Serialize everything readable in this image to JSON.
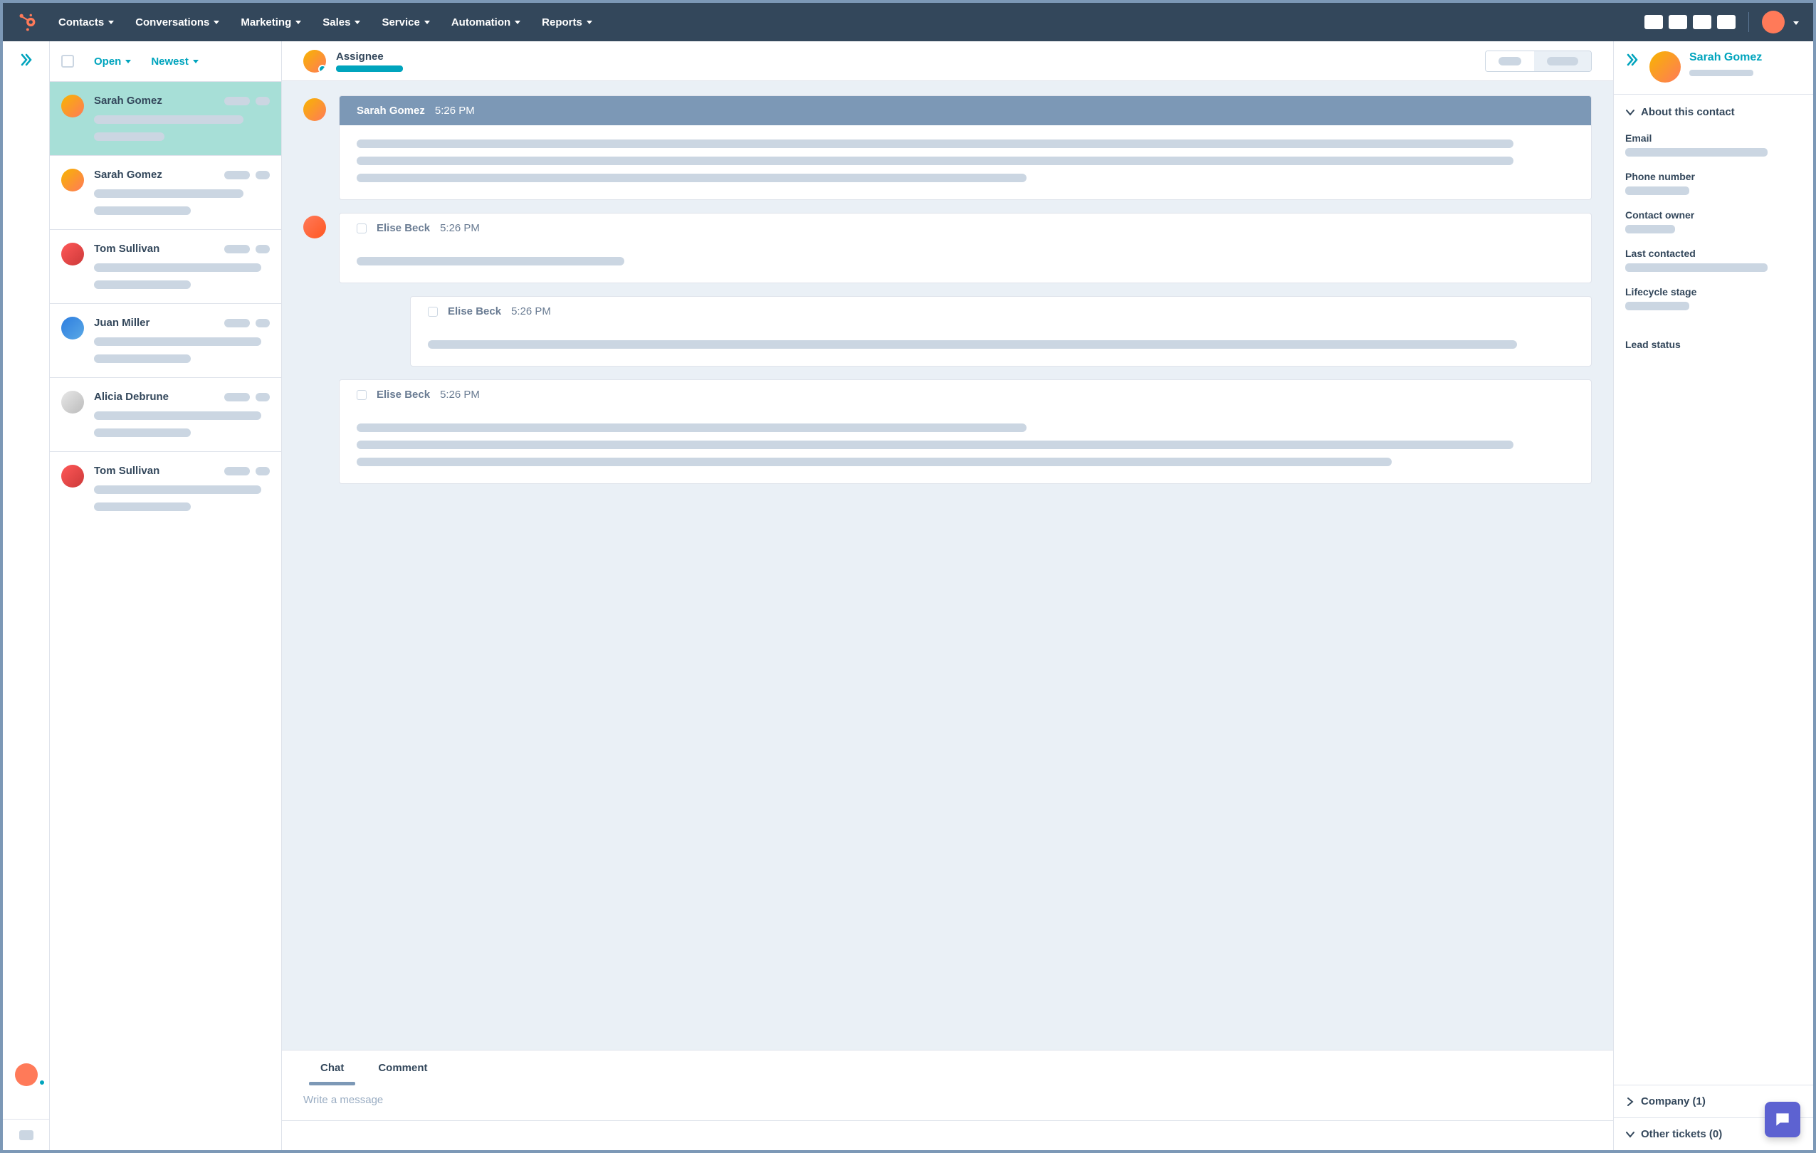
{
  "nav": {
    "contacts": "Contacts",
    "conversations": "Conversations",
    "marketing": "Marketing",
    "sales": "Sales",
    "service": "Service",
    "automation": "Automation",
    "reports": "Reports"
  },
  "inbox": {
    "filter_status": "Open",
    "filter_sort": "Newest",
    "items": [
      {
        "name": "Sarah Gomez",
        "active": true
      },
      {
        "name": "Sarah Gomez",
        "active": false
      },
      {
        "name": "Tom Sullivan",
        "active": false
      },
      {
        "name": "Juan Miller",
        "active": false
      },
      {
        "name": "Alicia Debrune",
        "active": false
      },
      {
        "name": "Tom Sullivan",
        "active": false
      }
    ]
  },
  "thread": {
    "assignee_label": "Assignee",
    "messages": [
      {
        "sender": "Sarah Gomez",
        "time": "5:26 PM",
        "style": "dark",
        "lines": 3
      },
      {
        "sender": "Elise Beck",
        "time": "5:26 PM",
        "style": "light",
        "lines": 1,
        "short": true
      },
      {
        "sender": "Elise Beck",
        "time": "5:26 PM",
        "style": "light",
        "lines": 1
      },
      {
        "sender": "Elise Beck",
        "time": "5:26 PM",
        "style": "light",
        "lines": 3
      }
    ],
    "tabs": {
      "chat": "Chat",
      "comment": "Comment"
    },
    "composer_placeholder": "Write a message"
  },
  "context": {
    "contact_name": "Sarah Gomez",
    "about_title": "About this contact",
    "fields": {
      "email": "Email",
      "phone": "Phone number",
      "owner": "Contact owner",
      "last_contacted": "Last contacted",
      "lifecycle": "Lifecycle stage",
      "lead_status": "Lead status"
    },
    "company_label": "Company (1)",
    "other_tickets_label": "Other tickets (0)"
  }
}
